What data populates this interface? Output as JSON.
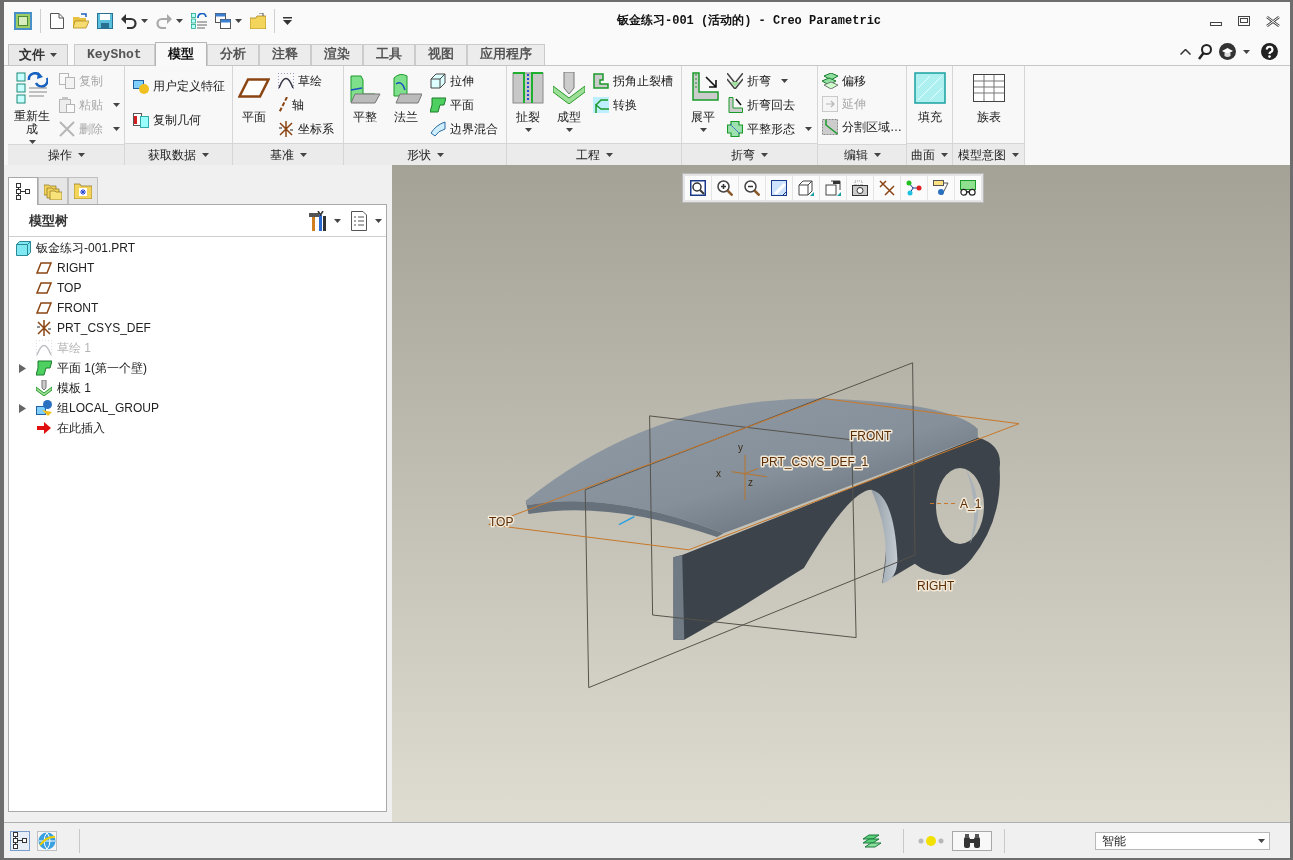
{
  "window": {
    "title": "钣金练习-001 (活动的) - Creo Parametric"
  },
  "quick_access": [
    {
      "disabled": false,
      "dropdown": false
    },
    {
      "disabled": false,
      "dropdown": false
    },
    {
      "disabled": false,
      "dropdown": false
    },
    {
      "disabled": false,
      "dropdown": true
    },
    {
      "disabled": true,
      "dropdown": true
    },
    {
      "disabled": false,
      "dropdown": false
    },
    {
      "disabled": false,
      "dropdown": true
    },
    {
      "disabled": false,
      "dropdown": false
    }
  ],
  "tabs": [
    {
      "label": "文件",
      "kind": "menu",
      "selected": false
    },
    {
      "label": "KeyShot",
      "kind": "tab",
      "selected": false
    },
    {
      "label": "模型",
      "kind": "tab",
      "selected": true
    },
    {
      "label": "分析",
      "kind": "tab",
      "selected": false
    },
    {
      "label": "注释",
      "kind": "tab",
      "selected": false
    },
    {
      "label": "渲染",
      "kind": "tab",
      "selected": false
    },
    {
      "label": "工具",
      "kind": "tab",
      "selected": false
    },
    {
      "label": "视图",
      "kind": "tab",
      "selected": false
    },
    {
      "label": "应用程序",
      "kind": "tab",
      "selected": false
    }
  ],
  "ribbon": {
    "groups": [
      {
        "label": "操作",
        "items": [
          {
            "kind": "large",
            "label": "重新生成",
            "dropdown": true,
            "disabled": false
          },
          {
            "kind": "column",
            "buttons": [
              {
                "label": "复制",
                "dropdown": false,
                "disabled": true
              },
              {
                "label": "粘贴",
                "dropdown": true,
                "disabled": true
              },
              {
                "label": "删除",
                "dropdown": true,
                "disabled": true
              }
            ]
          }
        ]
      },
      {
        "label": "获取数据",
        "items": [
          {
            "kind": "column",
            "buttons": [
              {
                "label": "用户定义特征",
                "dropdown": false,
                "disabled": false
              },
              {
                "label": "复制几何",
                "dropdown": false,
                "disabled": false
              }
            ]
          }
        ]
      },
      {
        "label": "基准",
        "items": [
          {
            "kind": "large",
            "label": "平面",
            "dropdown": false,
            "disabled": false
          },
          {
            "kind": "column",
            "buttons": [
              {
                "label": "草绘",
                "dropdown": false,
                "disabled": false
              },
              {
                "label": "轴",
                "dropdown": false,
                "disabled": false
              },
              {
                "label": "坐标系",
                "dropdown": false,
                "disabled": false
              }
            ]
          }
        ]
      },
      {
        "label": "形状",
        "items": [
          {
            "kind": "large",
            "label": "平整",
            "dropdown": false,
            "disabled": false
          },
          {
            "kind": "large",
            "label": "法兰",
            "dropdown": false,
            "disabled": false
          },
          {
            "kind": "column",
            "buttons": [
              {
                "label": "拉伸",
                "dropdown": false,
                "disabled": false
              },
              {
                "label": "平面",
                "dropdown": false,
                "disabled": false
              },
              {
                "label": "边界混合",
                "dropdown": false,
                "disabled": false
              }
            ]
          }
        ]
      },
      {
        "label": "工程",
        "items": [
          {
            "kind": "large",
            "label": "扯裂",
            "dropdown": true,
            "disabled": false
          },
          {
            "kind": "large",
            "label": "成型",
            "dropdown": true,
            "disabled": false
          },
          {
            "kind": "column",
            "buttons": [
              {
                "label": "拐角止裂槽",
                "dropdown": false,
                "disabled": false
              },
              {
                "label": "转换",
                "dropdown": false,
                "disabled": false
              }
            ]
          }
        ]
      },
      {
        "label": "折弯",
        "items": [
          {
            "kind": "large",
            "label": "展平",
            "dropdown": true,
            "disabled": false
          },
          {
            "kind": "column",
            "buttons": [
              {
                "label": "折弯",
                "dropdown": true,
                "disabled": false
              },
              {
                "label": "折弯回去",
                "dropdown": false,
                "disabled": false
              },
              {
                "label": "平整形态",
                "dropdown": true,
                "disabled": false
              }
            ]
          }
        ]
      },
      {
        "label": "编辑",
        "items": [
          {
            "kind": "column",
            "buttons": [
              {
                "label": "偏移",
                "dropdown": false,
                "disabled": false
              },
              {
                "label": "延伸",
                "dropdown": false,
                "disabled": true
              },
              {
                "label": "分割区域…",
                "dropdown": false,
                "disabled": false
              }
            ]
          }
        ]
      },
      {
        "label": "曲面",
        "items": [
          {
            "kind": "large",
            "label": "填充",
            "dropdown": false,
            "disabled": false
          }
        ]
      },
      {
        "label": "模型意图",
        "items": [
          {
            "kind": "large",
            "label": "族表",
            "dropdown": false,
            "disabled": false
          }
        ]
      }
    ]
  },
  "panel_tabs": [
    {
      "selected": true
    },
    {
      "selected": false
    },
    {
      "selected": false
    }
  ],
  "model_tree": {
    "title": "模型树",
    "items": [
      {
        "label": "钣金练习-001.PRT",
        "disabled": false,
        "children": [
          {
            "label": "RIGHT",
            "disabled": false
          },
          {
            "label": "TOP",
            "disabled": false
          },
          {
            "label": "FRONT",
            "disabled": false
          },
          {
            "label": "PRT_CSYS_DEF",
            "disabled": false
          },
          {
            "label": "草绘 1",
            "disabled": true
          },
          {
            "label": "平面 1(第一个壁)",
            "disabled": false,
            "expanded": false
          },
          {
            "label": "模板 1",
            "disabled": false
          },
          {
            "label": "组LOCAL_GROUP",
            "disabled": false,
            "expanded": false
          },
          {
            "label": "在此插入",
            "disabled": false
          }
        ]
      }
    ]
  },
  "viewport": {
    "labels": [
      {
        "text": "FRONT",
        "kind": "datum"
      },
      {
        "text": "y",
        "kind": "axis"
      },
      {
        "text": "PRT_CSYS_DEF_1",
        "kind": "datum"
      },
      {
        "text": "x",
        "kind": "axis"
      },
      {
        "text": "z",
        "kind": "axis"
      },
      {
        "text": "A_1",
        "kind": "datum"
      },
      {
        "text": "TOP",
        "kind": "datum"
      },
      {
        "text": "RIGHT",
        "kind": "datum"
      }
    ]
  },
  "status_bar": {
    "selection_filter": "智能"
  }
}
